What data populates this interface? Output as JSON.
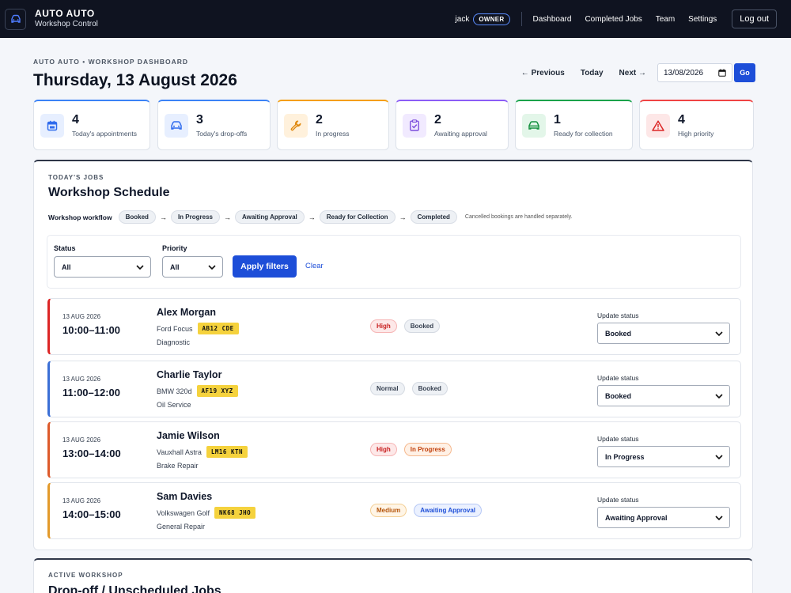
{
  "app": {
    "name": "AUTO AUTO",
    "subtitle": "Workshop Control"
  },
  "user": {
    "name": "jack",
    "role": "OWNER"
  },
  "nav": [
    {
      "id": "dashboard",
      "label": "Dashboard"
    },
    {
      "id": "completed",
      "label": "Completed Jobs"
    },
    {
      "id": "team",
      "label": "Team"
    },
    {
      "id": "settings",
      "label": "Settings"
    }
  ],
  "logout_label": "Log out",
  "page": {
    "eyebrow": "AUTO AUTO • WORKSHOP DASHBOARD",
    "title": "Thursday, 13 August 2026"
  },
  "date_nav": {
    "previous": "← Previous",
    "today": "Today",
    "next": "Next →",
    "date_value": "13/08/2026",
    "go": "Go"
  },
  "stats": [
    {
      "value": "4",
      "label": "Today's appointments",
      "icon": "calendar-icon",
      "accent": "#3b82f6",
      "icon_bg": "#e7efff"
    },
    {
      "value": "3",
      "label": "Today's drop-offs",
      "icon": "car-icon",
      "accent": "#3b82f6",
      "icon_bg": "#e7efff"
    },
    {
      "value": "2",
      "label": "In progress",
      "icon": "wrench-icon",
      "accent": "#f59e0b",
      "icon_bg": "#fff1dc"
    },
    {
      "value": "2",
      "label": "Awaiting approval",
      "icon": "clipboard-check-icon",
      "accent": "#8b5cf6",
      "icon_bg": "#f1eaff"
    },
    {
      "value": "1",
      "label": "Ready for collection",
      "icon": "car-ready-icon",
      "accent": "#16a34a",
      "icon_bg": "#e3f6e9"
    },
    {
      "value": "4",
      "label": "High priority",
      "icon": "warning-icon",
      "accent": "#ef4444",
      "icon_bg": "#fde7e7"
    }
  ],
  "schedule": {
    "eyebrow": "TODAY'S JOBS",
    "title": "Workshop Schedule",
    "workflow_label": "Workshop workflow",
    "workflow": [
      "Booked",
      "In Progress",
      "Awaiting Approval",
      "Ready for Collection",
      "Completed"
    ],
    "workflow_note": "Cancelled bookings are handled separately.",
    "filters": {
      "status_label": "Status",
      "status_value": "All",
      "priority_label": "Priority",
      "priority_value": "All",
      "apply": "Apply filters",
      "clear": "Clear"
    },
    "update_label": "Update status",
    "jobs": [
      {
        "date": "13 AUG 2026",
        "time": "10:00–11:00",
        "customer": "Alex Morgan",
        "vehicle": "Ford Focus",
        "plate": "AB12 CDE",
        "service": "Diagnostic",
        "priority": "High",
        "status": "Booked",
        "selected_status": "Booked",
        "accent": "#dc2626"
      },
      {
        "date": "13 AUG 2026",
        "time": "11:00–12:00",
        "customer": "Charlie Taylor",
        "vehicle": "BMW 320d",
        "plate": "AF19 XYZ",
        "service": "Oil Service",
        "priority": "Normal",
        "status": "Booked",
        "selected_status": "Booked",
        "accent": "#3b6fd6"
      },
      {
        "date": "13 AUG 2026",
        "time": "13:00–14:00",
        "customer": "Jamie Wilson",
        "vehicle": "Vauxhall Astra",
        "plate": "LM16 KTN",
        "service": "Brake Repair",
        "priority": "High",
        "status": "In Progress",
        "selected_status": "In Progress",
        "accent": "#dd5a2b"
      },
      {
        "date": "13 AUG 2026",
        "time": "14:00–15:00",
        "customer": "Sam Davies",
        "vehicle": "Volkswagen Golf",
        "plate": "NK68 JHO",
        "service": "General Repair",
        "priority": "Medium",
        "status": "Awaiting Approval",
        "selected_status": "Awaiting Approval",
        "accent": "#e39a2b"
      }
    ]
  },
  "active": {
    "eyebrow": "ACTIVE WORKSHOP",
    "title": "Drop-off / Unscheduled Jobs"
  },
  "colors": {
    "nav_bg": "#0f1320",
    "primary": "#1d4ed8",
    "plate": "#f5d23d"
  }
}
